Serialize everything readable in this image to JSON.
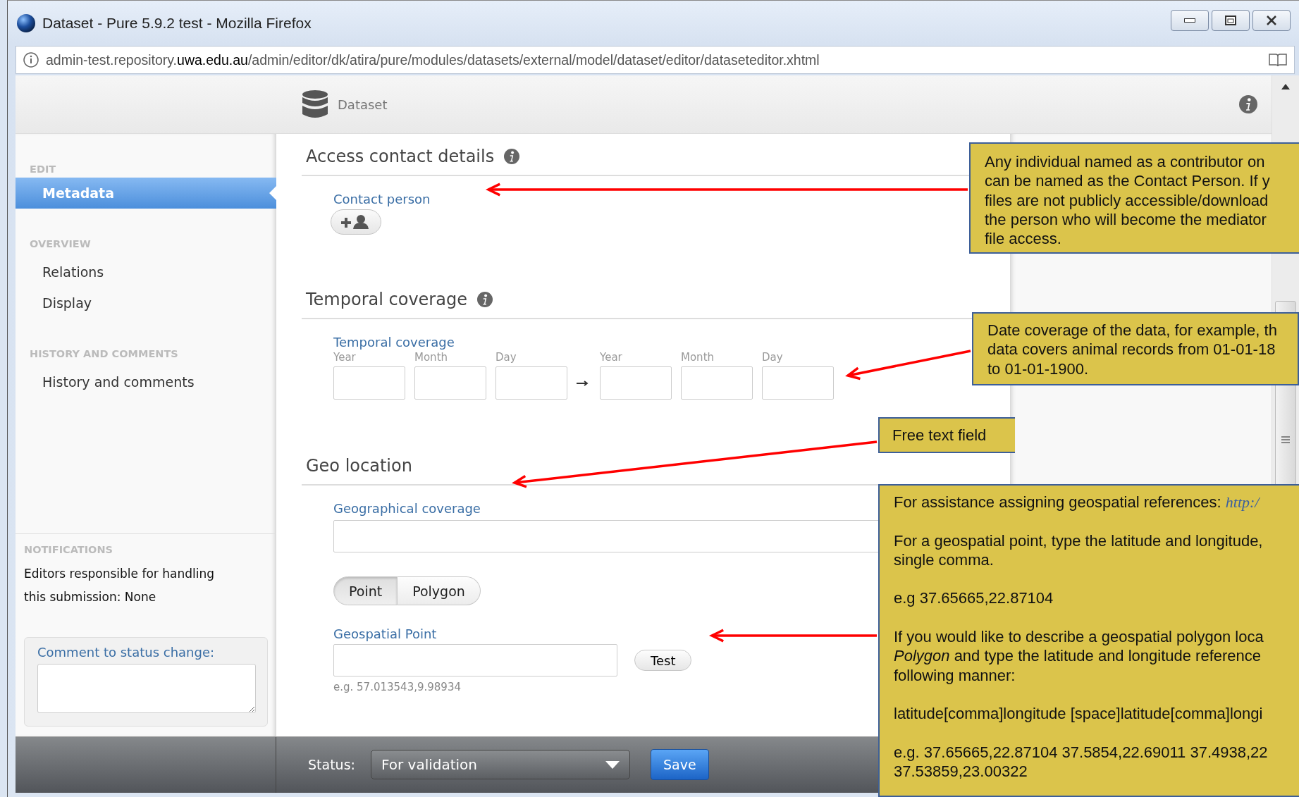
{
  "window": {
    "title": "Dataset - Pure 5.9.2 test - Mozilla Firefox"
  },
  "address_bar": {
    "url": "admin-test.repository.**uwa.edu.au**/admin/editor/dk/atira/pure/modules/datasets/external/model/dataset/editor/dataseteditor.xhtml"
  },
  "header": {
    "title": "Dataset"
  },
  "sidebar": {
    "sections": [
      {
        "heading": "EDIT",
        "items": [
          {
            "label": "Metadata",
            "selected": true
          }
        ]
      },
      {
        "heading": "OVERVIEW",
        "items": [
          {
            "label": "Relations",
            "selected": false
          },
          {
            "label": "Display",
            "selected": false
          }
        ]
      },
      {
        "heading": "HISTORY AND COMMENTS",
        "items": [
          {
            "label": "History and comments",
            "selected": false
          }
        ]
      }
    ]
  },
  "notifications": {
    "heading": "NOTIFICATIONS",
    "text": "Editors responsible for handling this submission: None",
    "comment_label": "Comment to status change:"
  },
  "contact": {
    "title": "Access contact details",
    "label": "Contact person"
  },
  "temporal": {
    "title": "Temporal coverage",
    "label": "Temporal coverage",
    "parts": [
      "Year",
      "Month",
      "Day",
      "Year",
      "Month",
      "Day"
    ]
  },
  "geo": {
    "title": "Geo location",
    "coverage_label": "Geographical coverage",
    "modes": [
      {
        "label": "Point",
        "selected": true
      },
      {
        "label": "Polygon",
        "selected": false
      }
    ],
    "point_label": "Geospatial Point",
    "test_button": "Test",
    "hint": "e.g. 57.013543,9.98934"
  },
  "status_bar": {
    "label": "Status:",
    "value": "For validation",
    "save_button": "Save"
  },
  "callouts": [
    {
      "paragraphs": [
        {
          "lines": [
            "Any individual named as a contributor on",
            "can be named as the Contact Person. If y",
            "files are not publicly accessible/download",
            "the person who will become the mediator",
            "file access."
          ]
        }
      ]
    },
    {
      "paragraphs": [
        {
          "lines": [
            "Date coverage of the data, for example, th",
            "data covers animal records from 01-01-18",
            "to 01-01-1900."
          ]
        }
      ]
    },
    {
      "paragraphs": [
        {
          "lines": [
            "Free text field"
          ]
        }
      ]
    },
    {
      "paragraphs": [
        {
          "lines": [
            "For assistance assigning geospatial references: "
          ],
          "link": "http:/"
        },
        {
          "lines": [
            "For a geospatial point, type the latitude and longitude,",
            "single comma."
          ]
        },
        {
          "lines": [
            "e.g 37.65665,22.87104"
          ]
        },
        {
          "lines": [
            "If you would like to describe a geospatial polygon loca",
            "*Polygon* and type the latitude and longitude reference",
            "following manner:"
          ]
        },
        {
          "lines": [
            "latitude[comma]longitude [space]latitude[comma]longi"
          ]
        },
        {
          "lines": [
            "e.g. 37.65665,22.87104 37.5854,22.69011 37.4938,22",
            "37.53859,23.00322"
          ]
        }
      ]
    }
  ]
}
